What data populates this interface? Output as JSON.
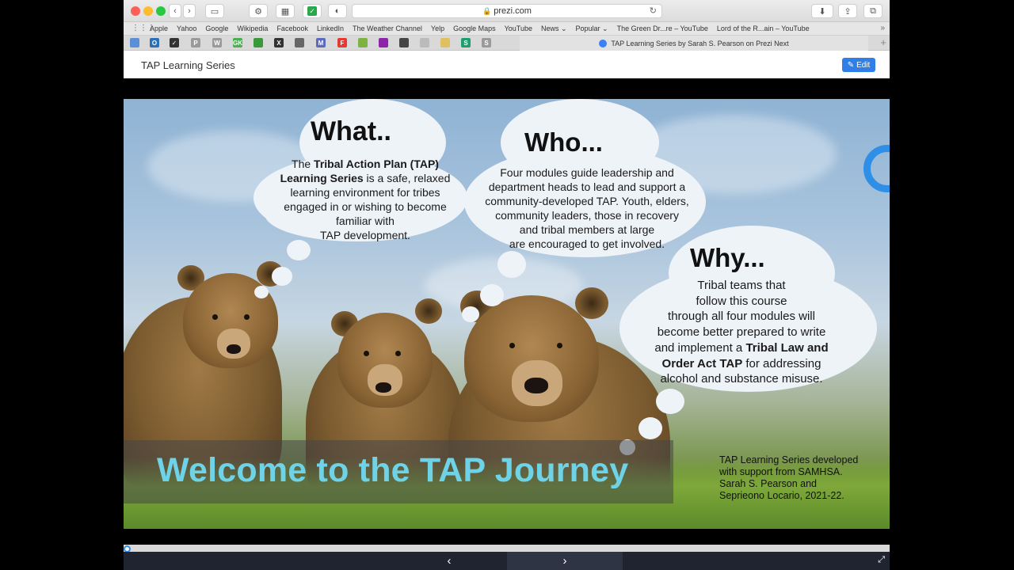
{
  "browser": {
    "url": "prezi.com",
    "bookmarks": [
      "Apple",
      "Yahoo",
      "Google",
      "Wikipedia",
      "Facebook",
      "LinkedIn",
      "The Weather Channel",
      "Yelp",
      "Google Maps",
      "YouTube",
      "News ⌄",
      "Popular ⌄",
      "The Green Dr...re – YouTube",
      "Lord of the R...ain – YouTube"
    ],
    "active_tab_title": "TAP Learning Series by Sarah S. Pearson on Prezi Next",
    "favicons": [
      {
        "letter": "",
        "color": "#5b8fd6"
      },
      {
        "letter": "O",
        "color": "#2a6fb8"
      },
      {
        "letter": "✓",
        "color": "#333333"
      },
      {
        "letter": "P",
        "color": "#9a9a9a"
      },
      {
        "letter": "W",
        "color": "#9a9a9a"
      },
      {
        "letter": "GK",
        "color": "#4caf50"
      },
      {
        "letter": "",
        "color": "#3a9a3a"
      },
      {
        "letter": "X",
        "color": "#333333"
      },
      {
        "letter": "",
        "color": "#666666"
      },
      {
        "letter": "M",
        "color": "#5c6bc0"
      },
      {
        "letter": "F",
        "color": "#e53935"
      },
      {
        "letter": "",
        "color": "#7cb342"
      },
      {
        "letter": "",
        "color": "#8e24aa"
      },
      {
        "letter": "",
        "color": "#444444"
      },
      {
        "letter": "",
        "color": "#bbbbbb"
      },
      {
        "letter": "",
        "color": "#e0c060"
      },
      {
        "letter": "S",
        "color": "#1e9e6e"
      },
      {
        "letter": "S",
        "color": "#9a9a9a"
      }
    ]
  },
  "prezi": {
    "title": "TAP Learning Series",
    "edit_label": "Edit"
  },
  "slide": {
    "what": {
      "title": "What..",
      "lines": [
        [
          {
            "t": "The ",
            "b": false
          },
          {
            "t": "Tribal Action Plan (TAP)",
            "b": true
          }
        ],
        [
          {
            "t": "Learning Series",
            "b": true
          },
          {
            "t": " is a safe, relaxed",
            "b": false
          }
        ],
        [
          {
            "t": "learning environment for tribes",
            "b": false
          }
        ],
        [
          {
            "t": "engaged in or wishing to become",
            "b": false
          }
        ],
        [
          {
            "t": "familiar with",
            "b": false
          }
        ],
        [
          {
            "t": "TAP development.",
            "b": false
          }
        ]
      ]
    },
    "who": {
      "title": "Who...",
      "lines": [
        "Four modules guide leadership and",
        "department heads to lead and support a",
        "community-developed TAP. Youth, elders,",
        "community leaders, those in recovery",
        "and tribal members at large",
        "are encouraged to get involved."
      ]
    },
    "why": {
      "title": "Why...",
      "lines": [
        [
          {
            "t": "Tribal teams that",
            "b": false
          }
        ],
        [
          {
            "t": "follow this course",
            "b": false
          }
        ],
        [
          {
            "t": "through all four modules will",
            "b": false
          }
        ],
        [
          {
            "t": "become better prepared to write",
            "b": false
          }
        ],
        [
          {
            "t": "and implement a ",
            "b": false
          },
          {
            "t": "Tribal Law and",
            "b": true
          }
        ],
        [
          {
            "t": "Order Act TAP",
            "b": true
          },
          {
            "t": " for addressing",
            "b": false
          }
        ],
        [
          {
            "t": "alcohol and substance misuse.",
            "b": false
          }
        ]
      ]
    },
    "welcome": "Welcome to the TAP Journey",
    "credit_lines": [
      "TAP Learning Series developed",
      "with support from SAMHSA.",
      "Sarah S. Pearson and",
      "Seprieono Locario, 2021-22."
    ]
  },
  "controls": {
    "prev": "‹",
    "next": "›",
    "progress": 0.0
  },
  "colors": {
    "accent": "#2f7fe6",
    "welcome_text": "#6fd3e8"
  }
}
